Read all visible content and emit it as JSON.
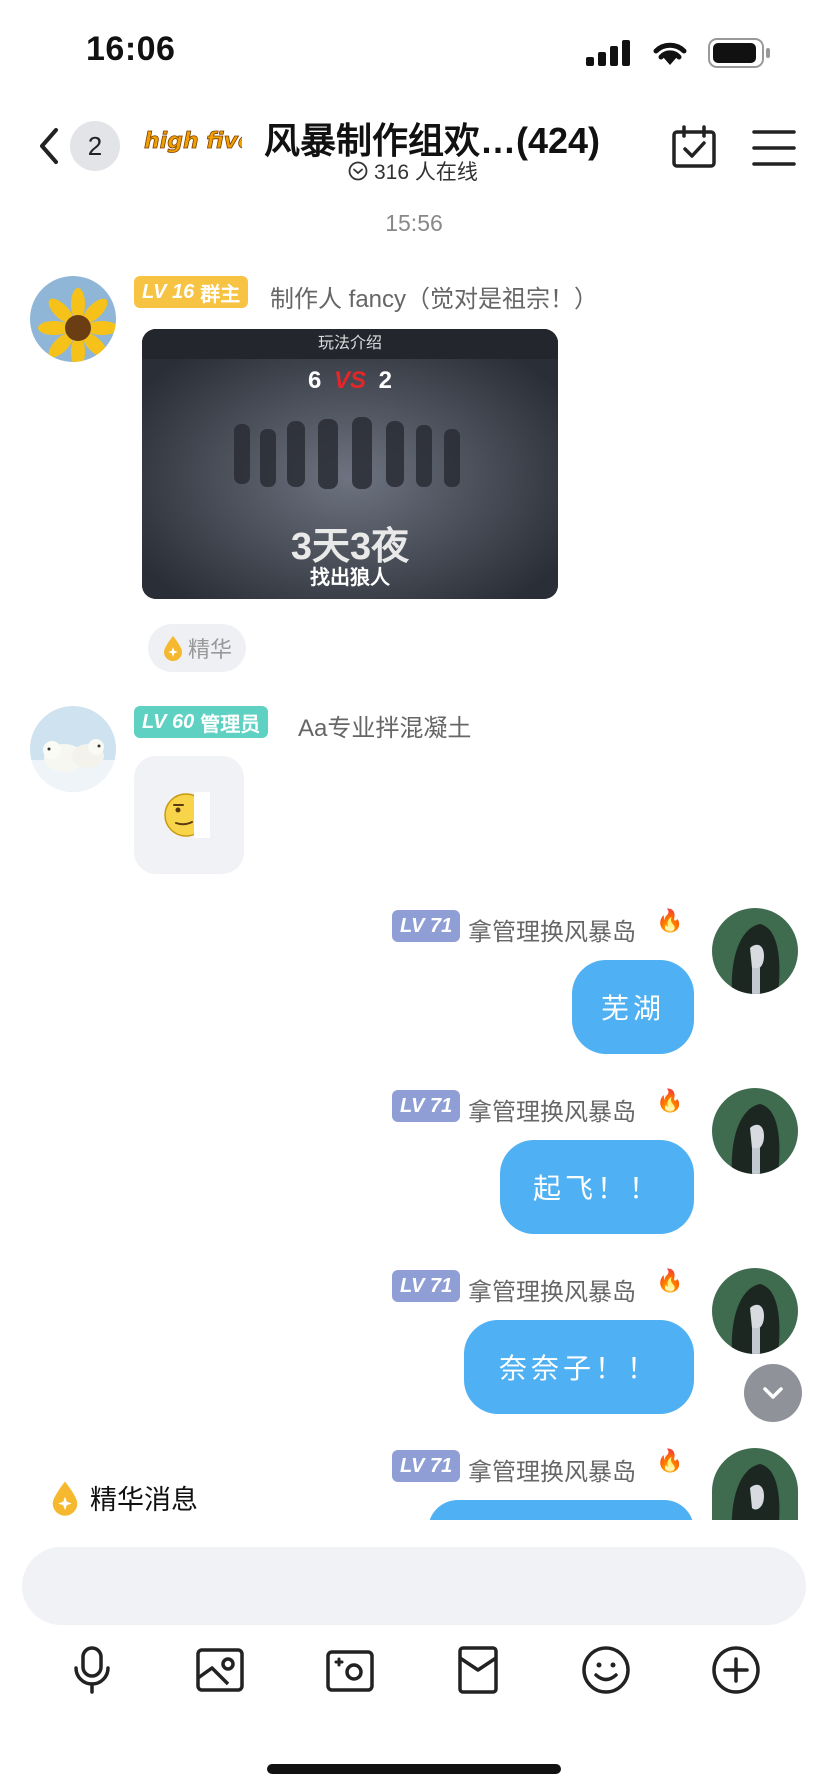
{
  "status_bar": {
    "time": "16:06"
  },
  "header": {
    "back_count": "2",
    "title": "风暴制作组欢…(424)",
    "online": "316 人在线"
  },
  "timestamp": "15:56",
  "messages": [
    {
      "level": "LV 16",
      "role": "群主",
      "name": "制作人 fancy（觉对是祖宗！）",
      "image_header": "玩法介绍",
      "image_line1_a": "6",
      "image_line1_b": "2",
      "image_vs": "VS",
      "image_big": "3天3夜",
      "image_sub": "找出狼人",
      "essence_label": "精华"
    },
    {
      "level": "LV 60",
      "role": "管理员",
      "name": "Aa专业拌混凝土"
    },
    {
      "level": "LV 71",
      "name": "拿管理换风暴岛",
      "text": "芜湖"
    },
    {
      "level": "LV 71",
      "name": "拿管理换风暴岛",
      "text": "起飞！！"
    },
    {
      "level": "LV 71",
      "name": "拿管理换风暴岛",
      "text": "奈奈子！！"
    },
    {
      "level": "LV 71",
      "name": "拿管理换风暴岛",
      "text": ""
    }
  ],
  "essence_bar": {
    "label": "精华消息"
  },
  "colors": {
    "owner_badge": "#f6c343",
    "admin_badge": "#5ed1c2",
    "level_badge": "#8f9fd6",
    "self_bubble": "#4fb1f3"
  }
}
